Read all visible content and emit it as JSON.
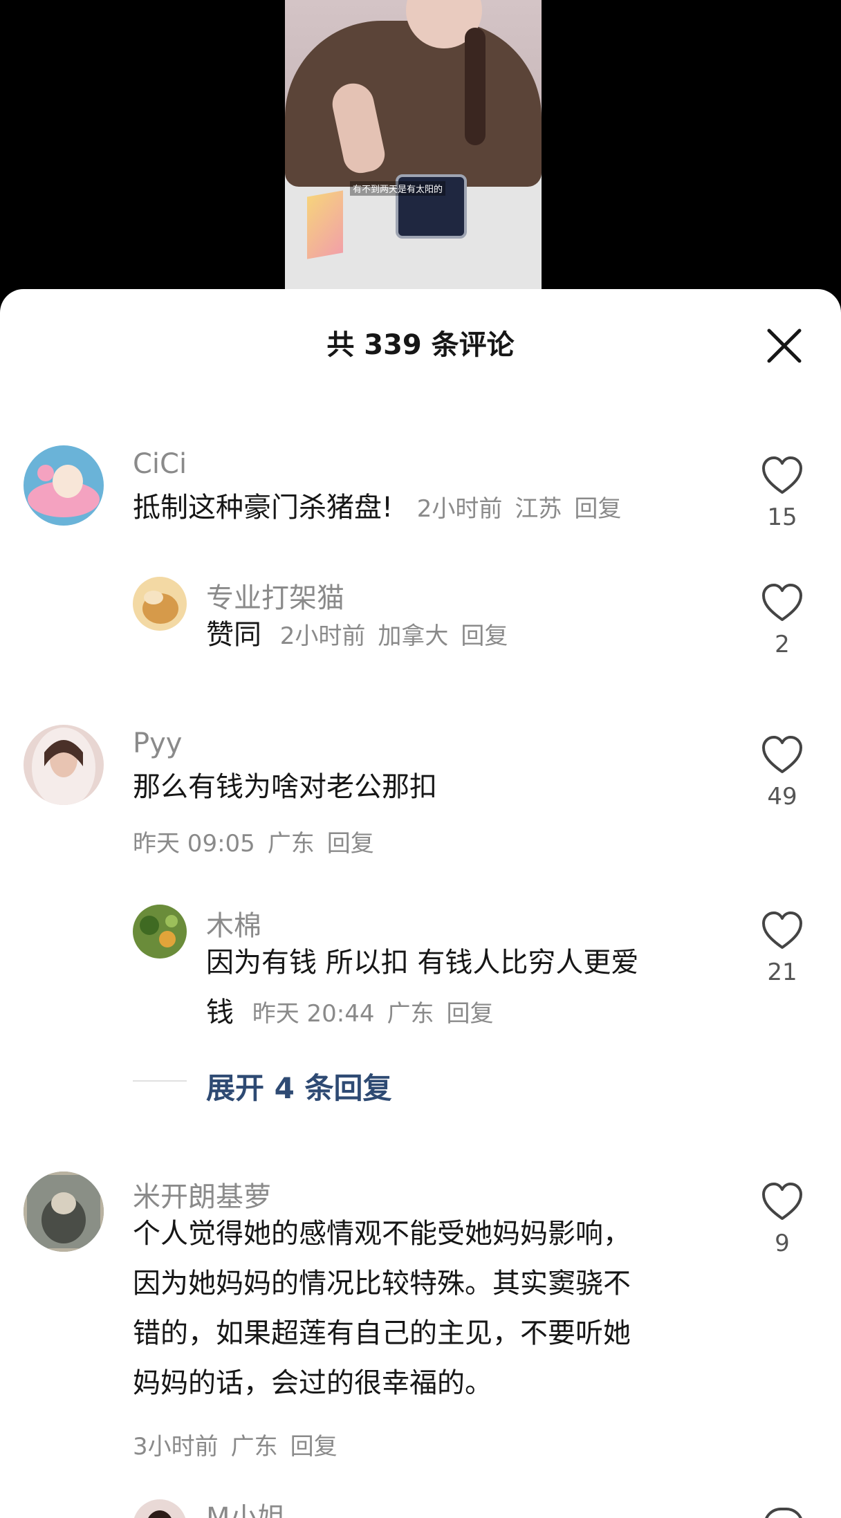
{
  "video": {
    "caption": "有不到两天是有太阳的"
  },
  "sheet": {
    "title": "共 339 条评论",
    "close_icon": "close-icon"
  },
  "comments": [
    {
      "user": "CiCi",
      "text": "抵制这种豪门杀猪盘!",
      "time": "2小时前",
      "location": "江苏",
      "reply": "回复",
      "likes": "15",
      "avatar_colors": [
        "#f4a2c0",
        "#6ab3d8"
      ]
    },
    {
      "user": "专业打架猫",
      "text": "赞同",
      "time": "2小时前",
      "location": "加拿大",
      "reply": "回复",
      "likes": "2",
      "avatar_colors": [
        "#f3d9a4",
        "#d69a4a"
      ]
    },
    {
      "user": "Pyy",
      "text": "那么有钱为啥对老公那扣",
      "time": "昨天 09:05",
      "location": "广东",
      "reply": "回复",
      "likes": "49",
      "avatar_colors": [
        "#e8d6d2",
        "#c89a86"
      ]
    },
    {
      "user": "木棉",
      "text_line1": "因为有钱 所以扣 有钱人比穷人更爱",
      "text_line2": "钱",
      "time": "昨天 20:44",
      "location": "广东",
      "reply": "回复",
      "likes": "21",
      "avatar_colors": [
        "#6a8c3a",
        "#e1a43a"
      ]
    },
    {
      "user": "米开朗基萝",
      "text_lines": [
        "个人觉得她的感情观不能受她妈妈影响，",
        "因为她妈妈的情况比较特殊。其实窦骁不",
        "错的，如果超莲有自己的主见，不要听她",
        "妈妈的话，会过的很幸福的。"
      ],
      "time": "3小时前",
      "location": "广东",
      "reply": "回复",
      "likes": "9",
      "avatar_colors": [
        "#8a8f86",
        "#4a4d47"
      ]
    },
    {
      "user": "M小姐"
    }
  ],
  "expand_replies": "展开 4 条回复",
  "icons": {
    "like": "heart-outline-icon"
  },
  "colors": {
    "text_primary": "#161616",
    "text_secondary": "#8a8a8a",
    "expand_link": "#2e4a73"
  }
}
